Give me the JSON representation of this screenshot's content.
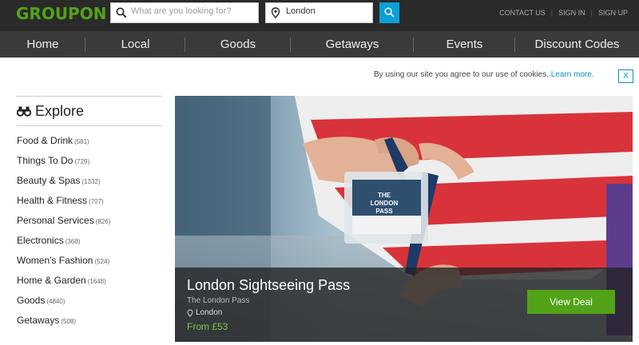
{
  "header": {
    "logo": "GROUPON",
    "search_placeholder": "What are you looking for?",
    "location_value": "London",
    "links": [
      "CONTACT US",
      "SIGN IN",
      "SIGN UP"
    ]
  },
  "nav": {
    "items": [
      "Home",
      "Local",
      "Goods",
      "Getaways",
      "Events",
      "Discount Codes"
    ]
  },
  "cookie": {
    "text": "By using our site you agree to our use of cookies.",
    "more_link": "Learn more.",
    "close": "X"
  },
  "sidebar": {
    "title": "Explore",
    "categories": [
      {
        "label": "Food & Drink",
        "count": "(581)"
      },
      {
        "label": "Things To Do",
        "count": "(729)"
      },
      {
        "label": "Beauty & Spas",
        "count": "(1332)"
      },
      {
        "label": "Health & Fitness",
        "count": "(707)"
      },
      {
        "label": "Personal Services",
        "count": "(826)"
      },
      {
        "label": "Electronics",
        "count": "(368)"
      },
      {
        "label": "Women's Fashion",
        "count": "(524)"
      },
      {
        "label": "Home & Garden",
        "count": "(1648)"
      },
      {
        "label": "Goods",
        "count": "(4840)"
      },
      {
        "label": "Getaways",
        "count": "(508)"
      }
    ]
  },
  "deal": {
    "title": "London Sightseeing Pass",
    "merchant": "The London Pass",
    "location": "London",
    "price": "From £53",
    "button": "View Deal",
    "card_text": "THE LONDON PASS"
  },
  "colors": {
    "brand_green": "#53a318",
    "search_blue": "#0a9fd6",
    "topbar": "#2a2a2a",
    "nav": "#3a3a3a"
  }
}
